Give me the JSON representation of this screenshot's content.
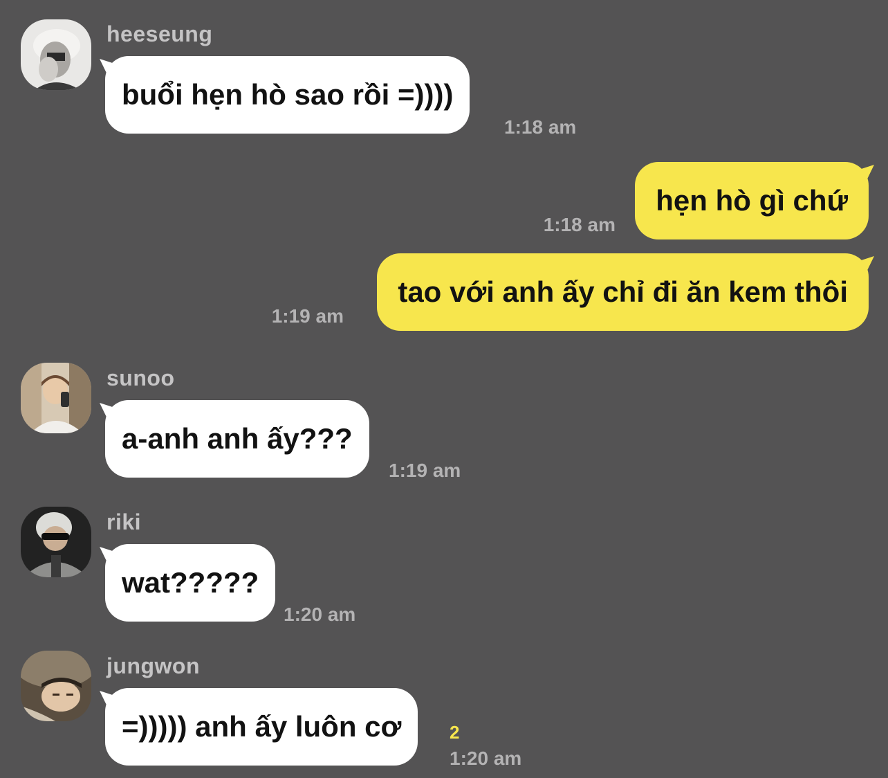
{
  "colors": {
    "background": "#545354",
    "incoming_bubble": "#ffffff",
    "outgoing_bubble": "#f7e64d",
    "sender_text": "#c5c4c5",
    "time_text": "#b4b3b4",
    "unread_count": "#f7e64d"
  },
  "messages": [
    {
      "sender": "heeseung",
      "text": "buổi hẹn hò sao rồi =))))",
      "time": "1:18 am"
    },
    {
      "text": "hẹn hò gì chứ",
      "time": "1:18 am"
    },
    {
      "text": "tao với anh ấy chỉ đi ăn kem thôi",
      "time": "1:19 am"
    },
    {
      "sender": "sunoo",
      "text": "a-anh anh ấy???",
      "time": "1:19 am"
    },
    {
      "sender": "riki",
      "text": "wat?????",
      "time": "1:20 am"
    },
    {
      "sender": "jungwon",
      "text": "=))))) anh ấy luôn cơ",
      "time": "1:20 am",
      "unread_count": "2"
    }
  ]
}
